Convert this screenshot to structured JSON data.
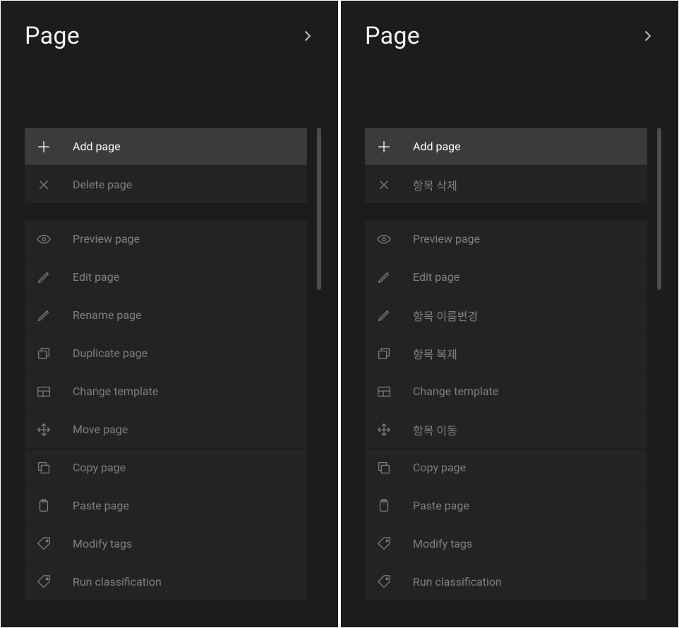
{
  "panels": [
    {
      "title": "Page",
      "groups": [
        [
          {
            "icon": "plus-icon",
            "label": "Add page",
            "active": true
          },
          {
            "icon": "close-icon",
            "label": "Delete page",
            "active": false
          }
        ],
        [
          {
            "icon": "eye-icon",
            "label": "Preview page",
            "active": false
          },
          {
            "icon": "pencil-icon",
            "label": "Edit page",
            "active": false
          },
          {
            "icon": "pencil-icon",
            "label": "Rename page",
            "active": false
          },
          {
            "icon": "duplicate-icon",
            "label": "Duplicate page",
            "active": false
          },
          {
            "icon": "template-icon",
            "label": "Change template",
            "active": false
          },
          {
            "icon": "move-icon",
            "label": "Move page",
            "active": false
          },
          {
            "icon": "copy-icon",
            "label": "Copy page",
            "active": false
          },
          {
            "icon": "clipboard-icon",
            "label": "Paste page",
            "active": false
          },
          {
            "icon": "tag-icon",
            "label": "Modify tags",
            "active": false
          },
          {
            "icon": "tag-icon",
            "label": "Run classification",
            "active": false
          }
        ]
      ]
    },
    {
      "title": "Page",
      "groups": [
        [
          {
            "icon": "plus-icon",
            "label": "Add page",
            "active": true
          },
          {
            "icon": "close-icon",
            "label": "항목 삭제",
            "active": false
          }
        ],
        [
          {
            "icon": "eye-icon",
            "label": "Preview page",
            "active": false
          },
          {
            "icon": "pencil-icon",
            "label": "Edit page",
            "active": false
          },
          {
            "icon": "pencil-icon",
            "label": "항목 이름변경",
            "active": false
          },
          {
            "icon": "duplicate-icon",
            "label": "항목 복제",
            "active": false
          },
          {
            "icon": "template-icon",
            "label": "Change template",
            "active": false
          },
          {
            "icon": "move-icon",
            "label": "항목 이동",
            "active": false
          },
          {
            "icon": "copy-icon",
            "label": "Copy page",
            "active": false
          },
          {
            "icon": "clipboard-icon",
            "label": "Paste page",
            "active": false
          },
          {
            "icon": "tag-icon",
            "label": "Modify tags",
            "active": false
          },
          {
            "icon": "tag-icon",
            "label": "Run classification",
            "active": false
          }
        ]
      ]
    }
  ]
}
